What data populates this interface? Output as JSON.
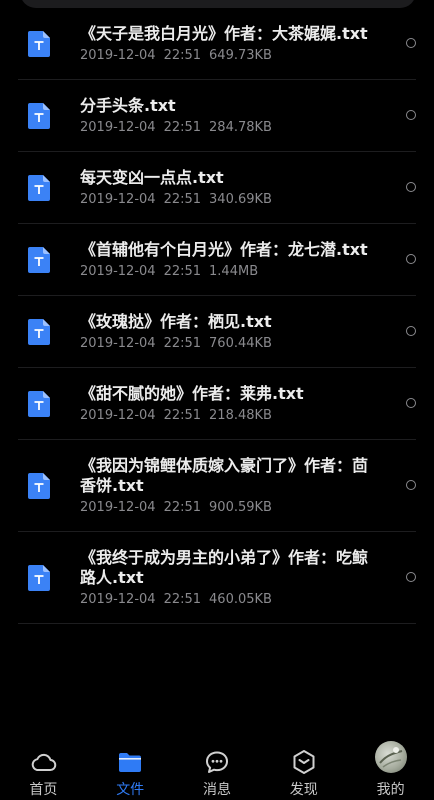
{
  "files": [
    {
      "name": "《天子是我白月光》作者：大茶娓娓.txt",
      "date": "2019-12-04",
      "time": "22:51",
      "size": "649.73KB",
      "icon": "txt-file-icon"
    },
    {
      "name": "分手头条.txt",
      "date": "2019-12-04",
      "time": "22:51",
      "size": "284.78KB",
      "icon": "txt-file-icon"
    },
    {
      "name": "每天变凶一点点.txt",
      "date": "2019-12-04",
      "time": "22:51",
      "size": "340.69KB",
      "icon": "txt-file-icon"
    },
    {
      "name": "《首辅他有个白月光》作者：龙七潜.txt",
      "date": "2019-12-04",
      "time": "22:51",
      "size": "1.44MB",
      "icon": "txt-file-icon"
    },
    {
      "name": "《玫瑰挞》作者：栖见.txt",
      "date": "2019-12-04",
      "time": "22:51",
      "size": "760.44KB",
      "icon": "txt-file-icon"
    },
    {
      "name": "《甜不腻的她》作者：莱弗.txt",
      "date": "2019-12-04",
      "time": "22:51",
      "size": "218.48KB",
      "icon": "txt-file-icon"
    },
    {
      "name": "《我因为锦鲤体质嫁入豪门了》作者：茴香饼.txt",
      "date": "2019-12-04",
      "time": "22:51",
      "size": "900.59KB",
      "icon": "txt-file-icon"
    },
    {
      "name": "《我终于成为男主的小弟了》作者：吃鲸路人.txt",
      "date": "2019-12-04",
      "time": "22:51",
      "size": "460.05KB",
      "icon": "txt-file-icon"
    }
  ],
  "tabs": [
    {
      "label": "首页",
      "icon": "cloud-icon"
    },
    {
      "label": "文件",
      "icon": "folder-icon"
    },
    {
      "label": "消息",
      "icon": "chat-bubble-icon"
    },
    {
      "label": "发现",
      "icon": "discover-hexagon-icon"
    },
    {
      "label": "我的",
      "icon": "avatar"
    }
  ],
  "colors": {
    "background": "#000000",
    "accent": "#2f7bf5",
    "file_icon": "#3b82f6",
    "secondary_text": "#8a8a8e"
  }
}
